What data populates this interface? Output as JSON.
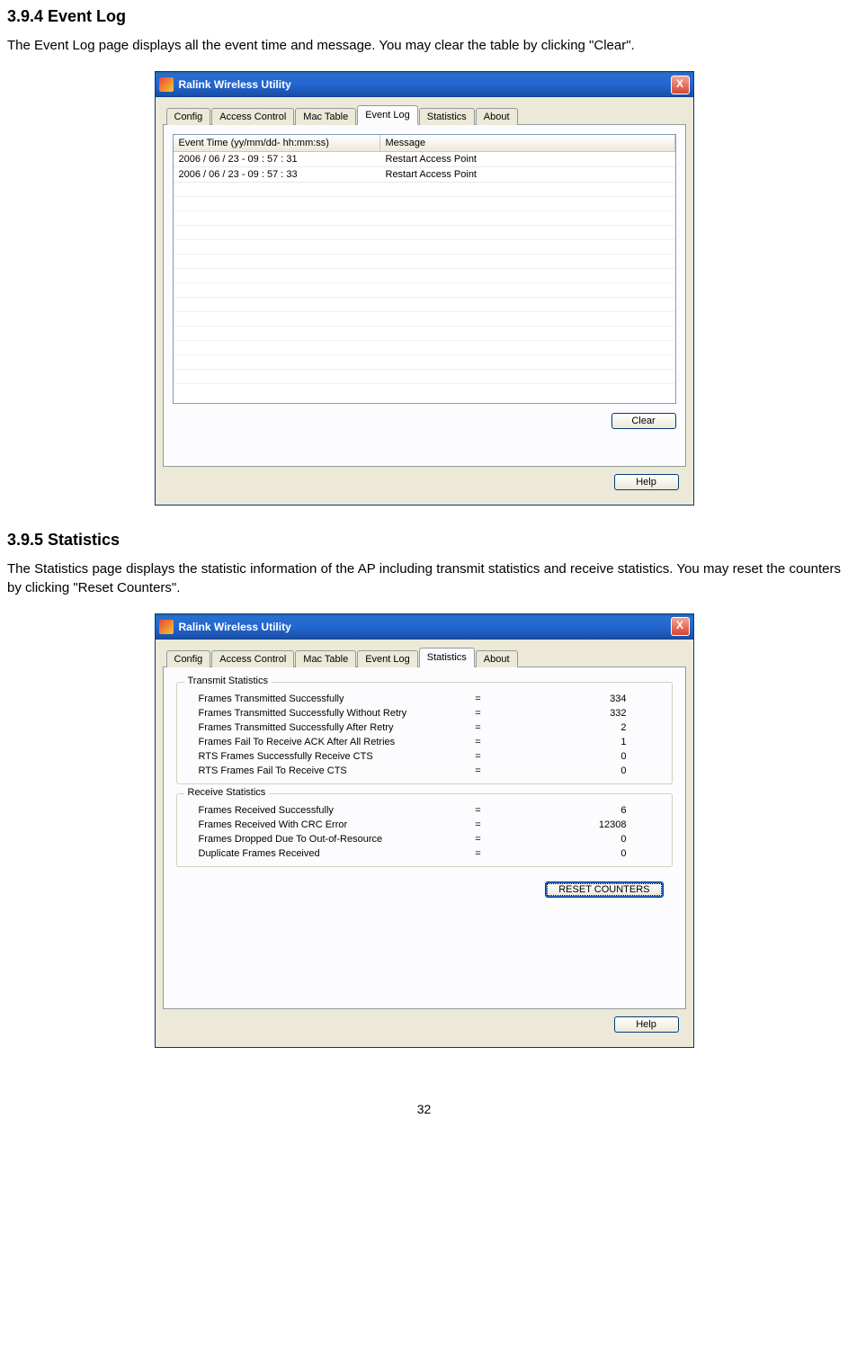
{
  "section1": {
    "heading": "3.9.4  Event Log",
    "intro": "The Event Log page displays all the event time and message. You may clear the table by clicking \"Clear\"."
  },
  "section2": {
    "heading": "3.9.5  Statistics",
    "intro": "The Statistics page displays the statistic information of the AP including transmit statistics and receive statistics. You may reset the counters by clicking \"Reset Counters\"."
  },
  "window": {
    "title": "Ralink Wireless Utility",
    "close_glyph": "X",
    "tabs": {
      "config": "Config",
      "access_control": "Access Control",
      "mac_table": "Mac Table",
      "event_log": "Event Log",
      "statistics": "Statistics",
      "about": "About"
    },
    "buttons": {
      "clear": "Clear",
      "help": "Help",
      "reset_counters": "RESET COUNTERS"
    }
  },
  "event_log": {
    "columns": {
      "time": "Event Time (yy/mm/dd- hh:mm:ss)",
      "message": "Message"
    },
    "rows": [
      {
        "time": "2006 / 06 / 23 - 09 : 57 : 31",
        "msg": "Restart Access Point"
      },
      {
        "time": "2006 / 06 / 23 - 09 : 57 : 33",
        "msg": "Restart Access Point"
      }
    ]
  },
  "statistics": {
    "transmit_legend": "Transmit Statistics",
    "receive_legend": "Receive Statistics",
    "transmit": [
      {
        "label": "Frames Transmitted Successfully",
        "value": "334"
      },
      {
        "label": "Frames Transmitted Successfully  Without Retry",
        "value": "332"
      },
      {
        "label": "Frames Transmitted Successfully After Retry",
        "value": "2"
      },
      {
        "label": "Frames Fail To Receive ACK After All Retries",
        "value": "1"
      },
      {
        "label": "RTS Frames Successfully Receive CTS",
        "value": "0"
      },
      {
        "label": "RTS Frames Fail To Receive CTS",
        "value": "0"
      }
    ],
    "receive": [
      {
        "label": "Frames Received Successfully",
        "value": "6"
      },
      {
        "label": "Frames Received With CRC Error",
        "value": "12308"
      },
      {
        "label": "Frames Dropped Due To Out-of-Resource",
        "value": "0"
      },
      {
        "label": "Duplicate Frames Received",
        "value": "0"
      }
    ]
  },
  "page_number": "32"
}
